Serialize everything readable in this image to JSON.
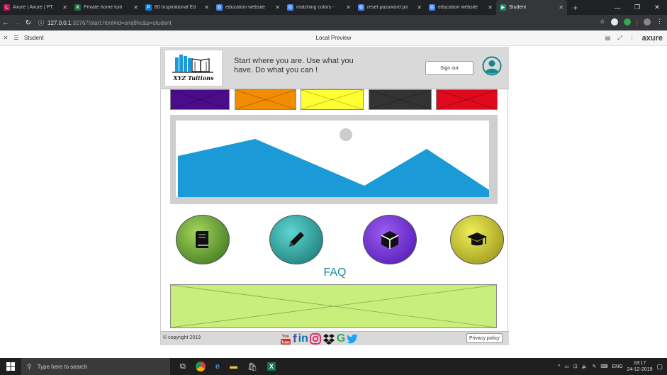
{
  "browser": {
    "tabs": [
      {
        "title": "Axure | Axure | PT",
        "icon_color": "#c2185b",
        "icon_letter": "L"
      },
      {
        "title": "Private home tuiti",
        "icon_color": "#1e7145",
        "icon_letter": "X"
      },
      {
        "title": "80 Inspirational Ed",
        "icon_color": "#1976d2",
        "icon_letter": "P"
      },
      {
        "title": "education website",
        "icon_color": "#4285f4",
        "icon_letter": "G"
      },
      {
        "title": "matching colors -",
        "icon_color": "#4285f4",
        "icon_letter": "G"
      },
      {
        "title": "reset password pa",
        "icon_color": "#4285f4",
        "icon_letter": "G"
      },
      {
        "title": "education website",
        "icon_color": "#4285f4",
        "icon_letter": "G"
      },
      {
        "title": "Student",
        "icon_color": "#1a8a6e",
        "icon_letter": "▶"
      }
    ],
    "active_tab_index": 7,
    "url_host": "127.0.0.1",
    "url_path": ":32767/start.html#id=omj8hc&p=student"
  },
  "axure_bar": {
    "page_name": "Student",
    "center_title": "Local Preview",
    "brand": "axure"
  },
  "header": {
    "logo_text": "XYZ Tuitions",
    "tagline": "Start where you are. Use what you have. Do what you can !",
    "signout_label": "Sign out"
  },
  "swatches": [
    "#4b0c8a",
    "#f28c00",
    "#ffff33",
    "#333333",
    "#e00a1e"
  ],
  "hero": {
    "sun_color": "#cccccc",
    "mountain_color": "#1a9ad6"
  },
  "feature_circles": [
    {
      "icon": "book-icon",
      "color_light": "#a6d65a",
      "color_dark": "#2f6b1a"
    },
    {
      "icon": "pencil-icon",
      "color_light": "#5ed6d0",
      "color_dark": "#13706e"
    },
    {
      "icon": "cube-icon",
      "color_light": "#9b5cf0",
      "color_dark": "#4a12b0"
    },
    {
      "icon": "graduation-cap-icon",
      "color_light": "#f0ef5a",
      "color_dark": "#8c8a10"
    }
  ],
  "faq": {
    "title": "FAQ"
  },
  "footer": {
    "copyright": "© copyright 2019",
    "privacy_label": "Privacy policy",
    "social": [
      "youtube-icon",
      "facebook-icon",
      "linkedin-icon",
      "instagram-icon",
      "dropbox-icon",
      "google-icon",
      "twitter-icon"
    ]
  },
  "taskbar": {
    "search_placeholder": "Type here to search",
    "language": "ENG",
    "time": "18:17",
    "date": "24-12-2019"
  }
}
